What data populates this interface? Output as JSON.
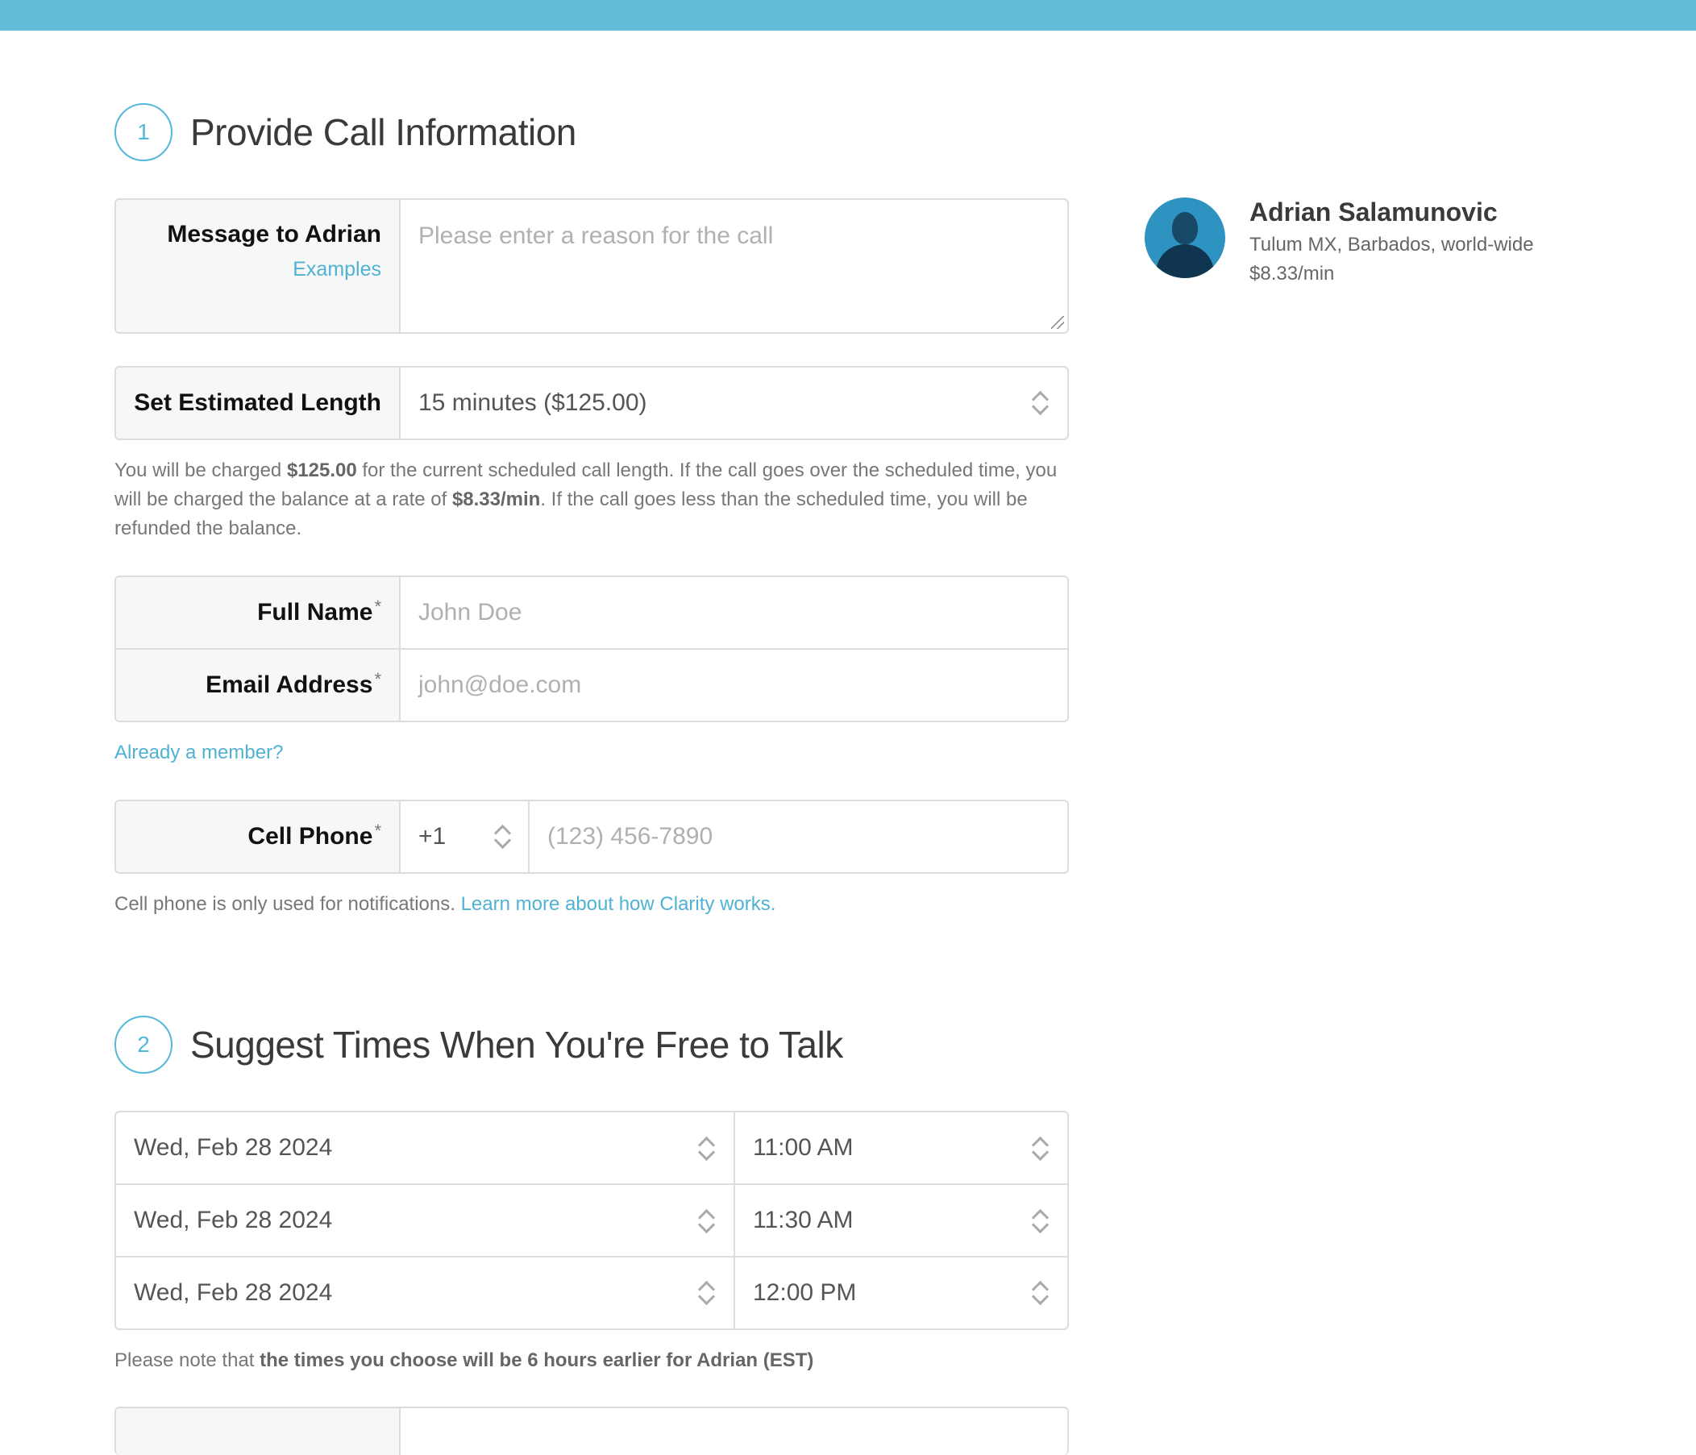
{
  "step1": {
    "number": "1",
    "title": "Provide Call Information"
  },
  "message": {
    "label": "Message to Adrian",
    "examples_link": "Examples",
    "placeholder": "Please enter a reason for the call"
  },
  "length": {
    "label": "Set Estimated Length",
    "value": "15 minutes ($125.00)"
  },
  "charge_note": {
    "p1": "You will be charged ",
    "amount": "$125.00",
    "p2": " for the current scheduled call length. If the call goes over the scheduled time, you will be charged the balance at a rate of ",
    "rate": "$8.33/min",
    "p3": ". If the call goes less than the scheduled time, you will be refunded the balance."
  },
  "full_name": {
    "label": "Full Name",
    "required": "*",
    "placeholder": "John Doe"
  },
  "email": {
    "label": "Email Address",
    "required": "*",
    "placeholder": "john@doe.com"
  },
  "member_link": "Already a member?",
  "phone": {
    "label": "Cell Phone",
    "required": "*",
    "country_code": "+1",
    "placeholder": "(123) 456-7890"
  },
  "phone_note": {
    "text": "Cell phone is only used for notifications. ",
    "link": "Learn more about how Clarity works."
  },
  "step2": {
    "number": "2",
    "title": "Suggest Times When You're Free to Talk"
  },
  "times": [
    {
      "date": "Wed, Feb 28 2024",
      "time": "11:00 AM"
    },
    {
      "date": "Wed, Feb 28 2024",
      "time": "11:30 AM"
    },
    {
      "date": "Wed, Feb 28 2024",
      "time": "12:00 PM"
    }
  ],
  "tz_note": {
    "p1": "Please note that ",
    "bold": "the times you choose will be 6 hours earlier for Adrian (EST)"
  },
  "expert": {
    "name": "Adrian Salamunovic",
    "location": "Tulum MX, Barbados, world-wide",
    "rate": "$8.33/min"
  },
  "colors": {
    "accent": "#55b8d8",
    "topbar": "#62bcd9"
  }
}
